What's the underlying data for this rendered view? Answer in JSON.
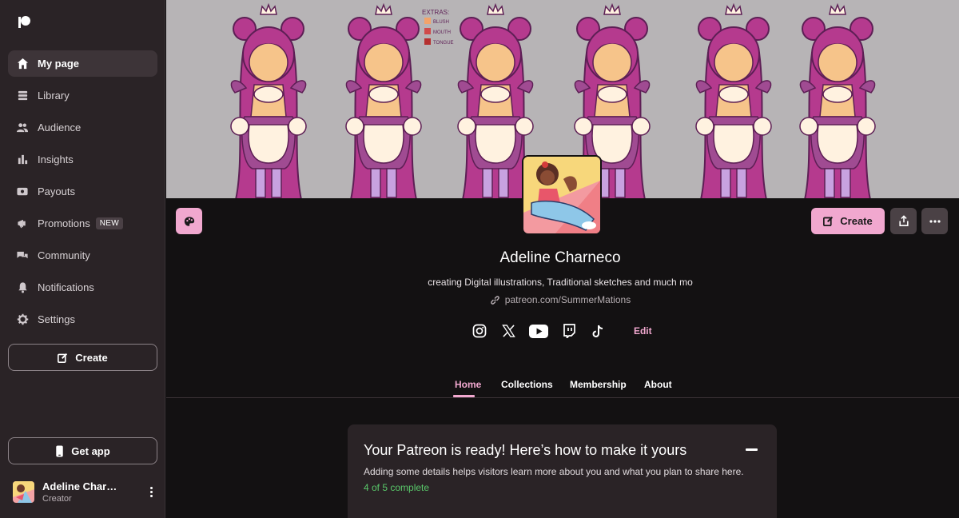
{
  "sidebar": {
    "items": [
      {
        "label": "My page",
        "icon": "home-icon",
        "active": true
      },
      {
        "label": "Library",
        "icon": "library-icon"
      },
      {
        "label": "Audience",
        "icon": "audience-icon"
      },
      {
        "label": "Insights",
        "icon": "insights-icon"
      },
      {
        "label": "Payouts",
        "icon": "payouts-icon"
      },
      {
        "label": "Promotions",
        "icon": "promotions-icon",
        "badge": "NEW"
      },
      {
        "label": "Community",
        "icon": "community-icon"
      },
      {
        "label": "Notifications",
        "icon": "bell-icon"
      },
      {
        "label": "Settings",
        "icon": "gear-icon"
      }
    ],
    "create_label": "Create",
    "get_app_label": "Get app",
    "user": {
      "name": "Adeline Charneco",
      "role": "Creator"
    }
  },
  "banner": {
    "extras_title": "EXTRAS:",
    "extras": [
      "BLUSH",
      "MOUTH",
      "TONGUE"
    ]
  },
  "profile": {
    "name": "Adeline Charneco",
    "tagline": "creating Digital illustrations, Traditional sketches and much mo",
    "link": "patreon.com/SummerMations",
    "create_label": "Create",
    "edit_label": "Edit",
    "socials": [
      "instagram-icon",
      "x-icon",
      "youtube-icon",
      "twitch-icon",
      "tiktok-icon"
    ]
  },
  "tabs": [
    {
      "label": "Home",
      "active": true
    },
    {
      "label": "Collections"
    },
    {
      "label": "Membership"
    },
    {
      "label": "About"
    }
  ],
  "card": {
    "title": "Your Patreon is ready! Here’s how to make it yours",
    "text": "Adding some details helps visitors learn more about you and what you plan to share here.",
    "progress": "4 of 5 complete"
  },
  "colors": {
    "accent": "#f1a8cf",
    "sidebar_bg": "#2a2326",
    "page_bg": "#131112",
    "success": "#59c86a"
  }
}
